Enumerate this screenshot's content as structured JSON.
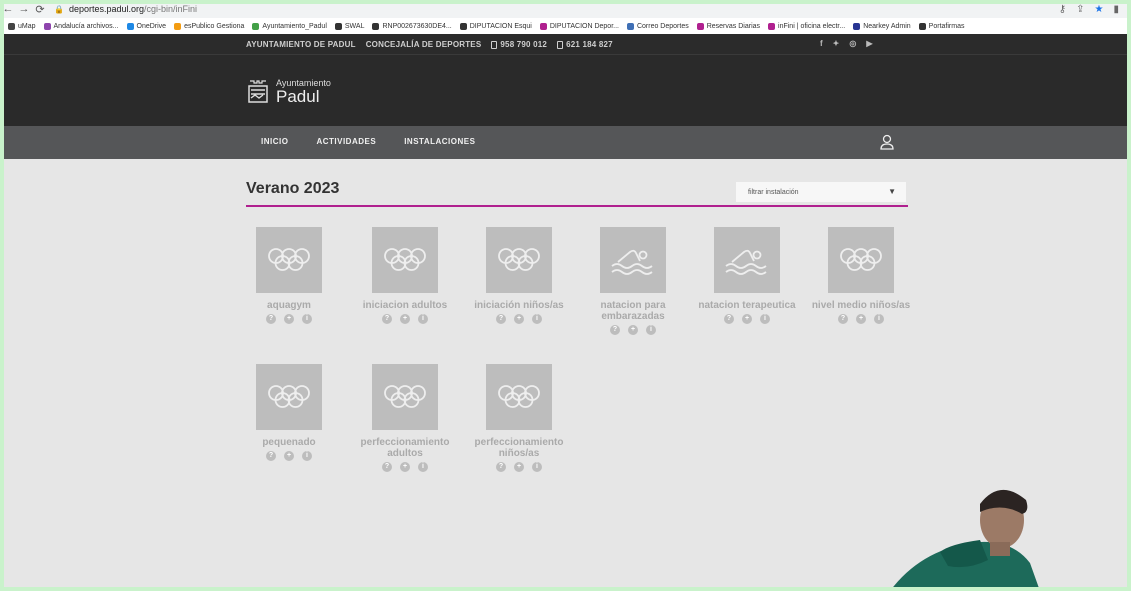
{
  "browser": {
    "url_host": "deportes.padul.org",
    "url_path": "/cgi-bin/inFini",
    "bookmarks": [
      {
        "label": "uMap",
        "color": "#444444"
      },
      {
        "label": "Andalucía archivos...",
        "color": "#8e44ad"
      },
      {
        "label": "OneDrive",
        "color": "#1e88e5"
      },
      {
        "label": "esPublico Gestiona",
        "color": "#f39c12"
      },
      {
        "label": "Ayuntamiento_Padul",
        "color": "#43a047"
      },
      {
        "label": "SWAL",
        "color": "#333333"
      },
      {
        "label": "RNP002673630DE4...",
        "color": "#333333"
      },
      {
        "label": "DIPUTACION Esqui",
        "color": "#333333"
      },
      {
        "label": "DIPUTACION Depor...",
        "color": "#b0208f"
      },
      {
        "label": "Correo Deportes",
        "color": "#3f6fb5"
      },
      {
        "label": "Reservas Diarias",
        "color": "#b0208f"
      },
      {
        "label": "inFini | oficina electr...",
        "color": "#b0208f"
      },
      {
        "label": "Nearkey Admin",
        "color": "#283593"
      },
      {
        "label": "Portafirmas",
        "color": "#333333"
      }
    ]
  },
  "topbar": {
    "org": "AYUNTAMIENTO DE PADUL",
    "dept": "CONCEJALÍA DE DEPORTES",
    "phone1": "958 790 012",
    "phone2": "621 184 827"
  },
  "logo": {
    "line1": "Ayuntamiento",
    "line2": "Padul"
  },
  "menu": {
    "inicio": "INICIO",
    "actividades": "ACTIVIDADES",
    "instalaciones": "INSTALACIONES"
  },
  "page": {
    "title": "Verano 2023",
    "filter_placeholder": "filtrar instalación"
  },
  "activities": [
    {
      "name": "aquagym",
      "icon": "olympic-rings-icon"
    },
    {
      "name": "iniciacion adultos",
      "icon": "olympic-rings-icon"
    },
    {
      "name": "iniciación niños/as",
      "icon": "olympic-rings-icon"
    },
    {
      "name": "natacion para embarazadas",
      "icon": "swimmer-icon"
    },
    {
      "name": "natacion terapeutica",
      "icon": "swimmer-icon"
    },
    {
      "name": "nivel medio niños/as",
      "icon": "olympic-rings-icon"
    },
    {
      "name": "pequenado",
      "icon": "olympic-rings-icon"
    },
    {
      "name": "perfeccionamiento adultos",
      "icon": "olympic-rings-icon"
    },
    {
      "name": "perfeccionamiento niños/as",
      "icon": "olympic-rings-icon"
    }
  ],
  "colors": {
    "accent": "#b0208f",
    "header_bg": "#2a2a2a",
    "menu_bg": "#555658"
  }
}
